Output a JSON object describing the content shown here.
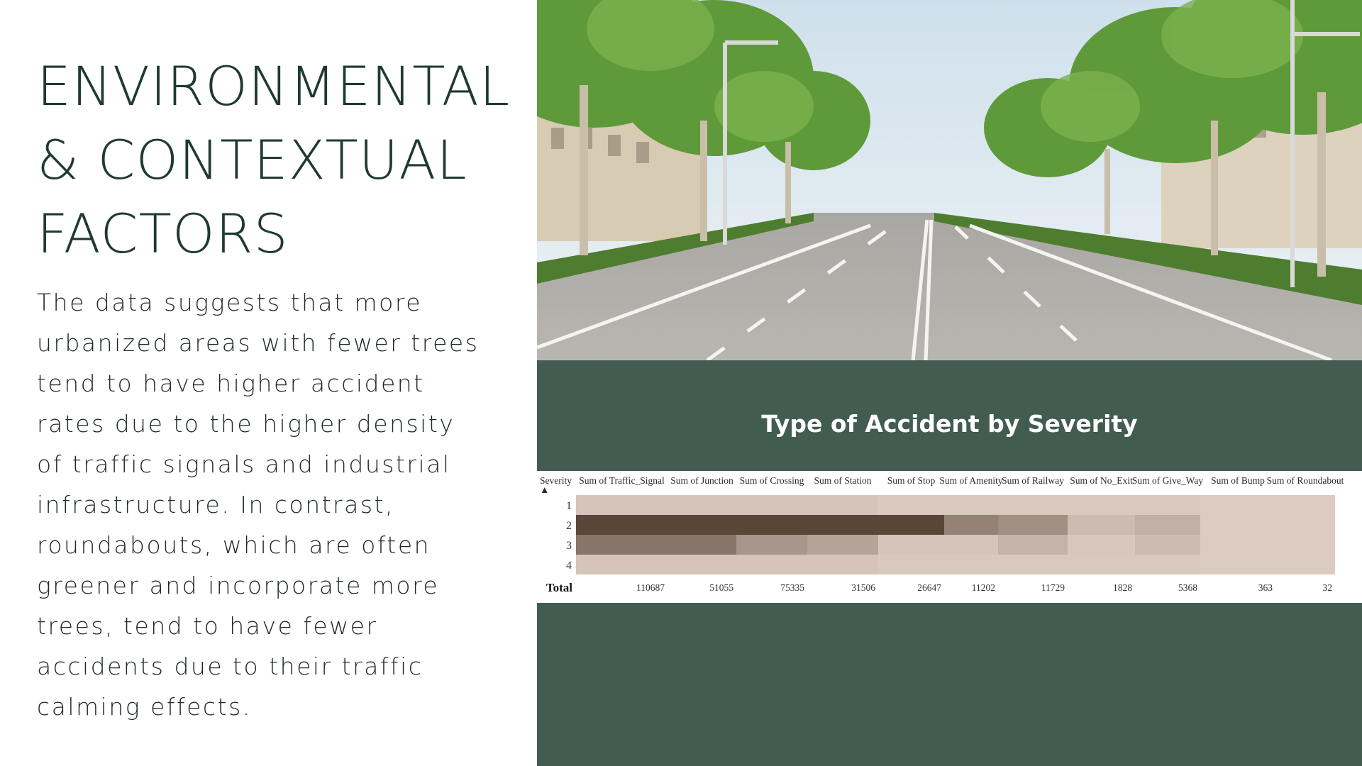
{
  "slide": {
    "title_lines": [
      "ENVIRONMENTAL",
      "& CONTEXTUAL",
      "FACTORS"
    ],
    "body_lines": [
      "The data suggests that more",
      "urbanized areas with fewer trees",
      "tend to have higher accident",
      "rates due to the higher density",
      "of traffic signals and industrial",
      "infrastructure. In contrast,",
      "roundabouts, which are often",
      "greener and incorporate more",
      "trees, tend to have fewer",
      "accidents due to their traffic",
      "calming effects."
    ]
  },
  "colors": {
    "panel_green": "#425c52",
    "title_dark_green": "#1e3a31",
    "heat_low": "#dccbc1",
    "heat_high": "#5b4539"
  },
  "chart_data": {
    "type": "heatmap",
    "title": "Type of Accident by Severity",
    "row_header": "Severity",
    "sort_indicator": "▲",
    "columns": [
      "Sum of Traffic_Signal",
      "Sum of Junction",
      "Sum of Crossing",
      "Sum of Station",
      "Sum of Stop",
      "Sum of Amenity",
      "Sum of Railway",
      "Sum of No_Exit",
      "Sum of Give_Way",
      "Sum of Bump",
      "Sum of Roundabout"
    ],
    "rows": [
      "1",
      "2",
      "3",
      "4"
    ],
    "intensity": [
      [
        0.05,
        0.05,
        0.05,
        0.05,
        0.02,
        0.02,
        0.02,
        0.02,
        0.02,
        0.0,
        0.0
      ],
      [
        1.0,
        1.0,
        1.0,
        1.0,
        1.0,
        0.55,
        0.45,
        0.12,
        0.2,
        0.0,
        0.0
      ],
      [
        0.65,
        0.65,
        0.4,
        0.3,
        0.05,
        0.05,
        0.18,
        0.03,
        0.12,
        0.0,
        0.0
      ],
      [
        0.05,
        0.05,
        0.05,
        0.05,
        0.02,
        0.02,
        0.02,
        0.02,
        0.02,
        0.0,
        0.0
      ]
    ],
    "total_label": "Total",
    "totals": [
      110687,
      51055,
      75335,
      31506,
      26647,
      11202,
      11729,
      1828,
      5368,
      363,
      32
    ]
  }
}
